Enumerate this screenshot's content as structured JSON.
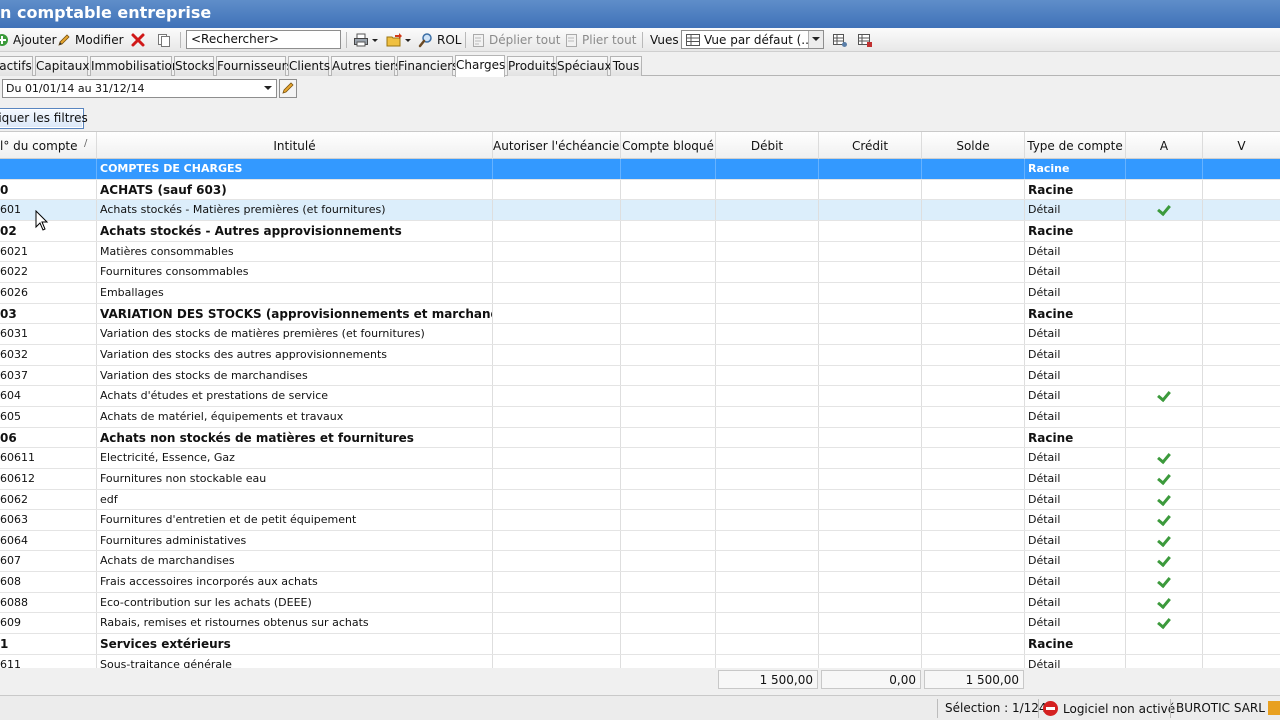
{
  "window": {
    "title": "n comptable entreprise"
  },
  "toolbar": {
    "add_label": "Ajouter",
    "modify_label": "Modifier",
    "search_value": "<Rechercher>",
    "rol_label": "ROL",
    "expand_all_label": "Déplier tout",
    "collapse_all_label": "Plier tout",
    "views_label": "Vues",
    "views_value": "Vue par défaut (..."
  },
  "tabs": [
    {
      "label": "actifs"
    },
    {
      "label": "Capitaux"
    },
    {
      "label": "Immobilisations"
    },
    {
      "label": "Stocks"
    },
    {
      "label": "Fournisseurs"
    },
    {
      "label": "Clients"
    },
    {
      "label": "Autres tiers"
    },
    {
      "label": "Financiers"
    },
    {
      "label": "Charges",
      "active": true
    },
    {
      "label": "Produits"
    },
    {
      "label": "Spéciaux"
    },
    {
      "label": "Tous"
    }
  ],
  "filter": {
    "period_value": "Du 01/01/14 au 31/12/14",
    "apply_label": "liquer les filtres"
  },
  "table": {
    "columns": {
      "account_no": "l° du compte",
      "sort_indicator": "/",
      "label": "Intitulé",
      "schedule": "Autoriser l'échéancier",
      "blocked": "Compte bloqué",
      "debit": "Débit",
      "credit": "Crédit",
      "balance": "Solde",
      "type": "Type de compte",
      "a": "A",
      "v": "V"
    },
    "rows": [
      {
        "no": "",
        "label": "COMPTES DE CHARGES",
        "type": "Racine",
        "a": false,
        "style": "selected"
      },
      {
        "no": "0",
        "label": "ACHATS (sauf 603)",
        "type": "Racine",
        "a": false,
        "style": "bold"
      },
      {
        "no": "601",
        "label": "Achats stockés - Matières premières (et fournitures)",
        "type": "Détail",
        "a": true,
        "style": "hover"
      },
      {
        "no": "02",
        "label": "Achats stockés - Autres approvisionnements",
        "type": "Racine",
        "a": false,
        "style": "bold"
      },
      {
        "no": "6021",
        "label": "Matières consommables",
        "type": "Détail",
        "a": false,
        "style": ""
      },
      {
        "no": "6022",
        "label": "Fournitures consommables",
        "type": "Détail",
        "a": false,
        "style": ""
      },
      {
        "no": "6026",
        "label": "Emballages",
        "type": "Détail",
        "a": false,
        "style": ""
      },
      {
        "no": "03",
        "label": "VARIATION DES STOCKS (approvisionnements et marchandises)",
        "type": "Racine",
        "a": false,
        "style": "bold"
      },
      {
        "no": "6031",
        "label": "Variation des stocks de matières premières (et fournitures)",
        "type": "Détail",
        "a": false,
        "style": ""
      },
      {
        "no": "6032",
        "label": "Variation des stocks des autres approvisionnements",
        "type": "Détail",
        "a": false,
        "style": ""
      },
      {
        "no": "6037",
        "label": "Variation des stocks de marchandises",
        "type": "Détail",
        "a": false,
        "style": ""
      },
      {
        "no": "604",
        "label": "Achats d'études et prestations de service",
        "type": "Détail",
        "a": true,
        "style": ""
      },
      {
        "no": "605",
        "label": "Achats de matériel, équipements et travaux",
        "type": "Détail",
        "a": false,
        "style": ""
      },
      {
        "no": "06",
        "label": "Achats non stockés de matières et fournitures",
        "type": "Racine",
        "a": false,
        "style": "bold"
      },
      {
        "no": "60611",
        "label": "Electricité, Essence, Gaz",
        "type": "Détail",
        "a": true,
        "style": ""
      },
      {
        "no": "60612",
        "label": "Fournitures non stockable eau",
        "type": "Détail",
        "a": true,
        "style": ""
      },
      {
        "no": "6062",
        "label": "edf",
        "type": "Détail",
        "a": true,
        "style": ""
      },
      {
        "no": "6063",
        "label": "Fournitures d'entretien et de petit équipement",
        "type": "Détail",
        "a": true,
        "style": ""
      },
      {
        "no": "6064",
        "label": "Fournitures administatives",
        "type": "Détail",
        "a": true,
        "style": ""
      },
      {
        "no": "607",
        "label": "Achats de marchandises",
        "type": "Détail",
        "a": true,
        "style": ""
      },
      {
        "no": "608",
        "label": "Frais accessoires incorporés aux achats",
        "type": "Détail",
        "a": true,
        "style": ""
      },
      {
        "no": "6088",
        "label": "Eco-contribution sur les achats (DEEE)",
        "type": "Détail",
        "a": true,
        "style": ""
      },
      {
        "no": "609",
        "label": "Rabais, remises et ristournes obtenus sur achats",
        "type": "Détail",
        "a": true,
        "style": ""
      },
      {
        "no": "1",
        "label": "Services extérieurs",
        "type": "Racine",
        "a": false,
        "style": "bold"
      },
      {
        "no": "611",
        "label": "Sous-traitance générale",
        "type": "Détail",
        "a": false,
        "style": ""
      }
    ],
    "totals": {
      "debit": "1 500,00",
      "credit": "0,00",
      "balance": "1 500,00"
    }
  },
  "statusbar": {
    "selection": "Sélection : 1/124",
    "activation": "Logiciel non activé",
    "company": "BUROTIC SARL"
  }
}
